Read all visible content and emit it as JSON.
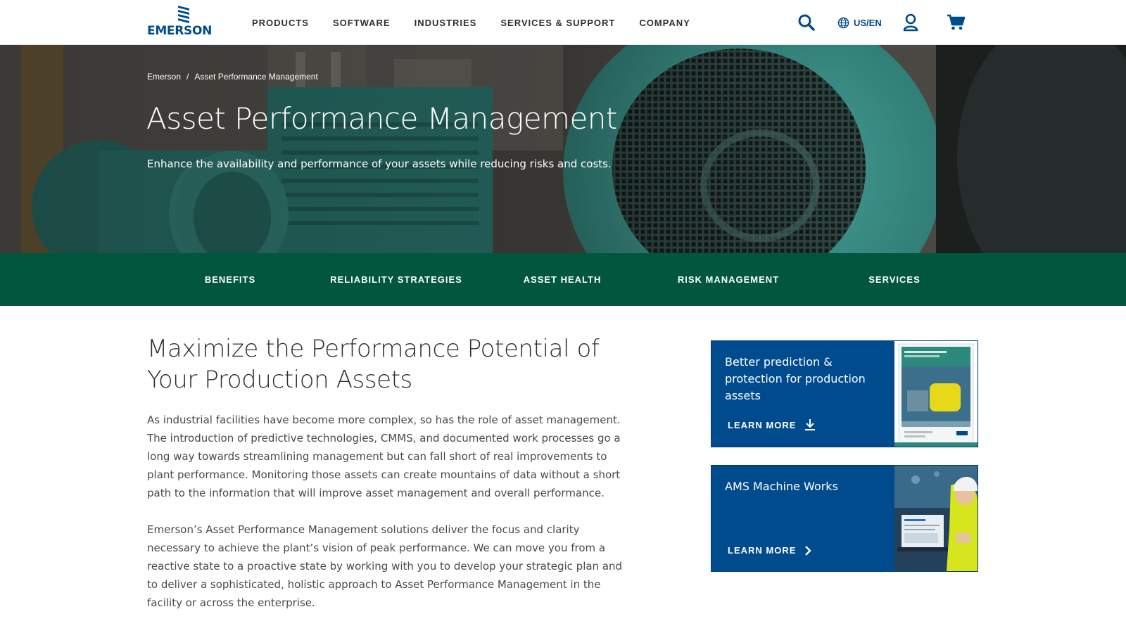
{
  "header": {
    "logo_text": "EMERSON",
    "nav": [
      "PRODUCTS",
      "SOFTWARE",
      "INDUSTRIES",
      "SERVICES & SUPPORT",
      "COMPANY"
    ],
    "locale": "US/EN",
    "icons": [
      "search-icon",
      "globe-icon",
      "user-icon",
      "cart-icon"
    ],
    "brand_color": "#004b8d"
  },
  "hero": {
    "breadcrumb": [
      "Emerson",
      "/",
      "Asset Performance Management"
    ],
    "title": "Asset Performance Management",
    "subtitle": "Enhance the availability and performance of your assets while reducing risks and costs."
  },
  "subnav": {
    "items": [
      "BENEFITS",
      "RELIABILITY STRATEGIES",
      "ASSET HEALTH",
      "RISK MANAGEMENT",
      "SERVICES"
    ],
    "background": "#00573d"
  },
  "main": {
    "heading": "Maximize the Performance Potential of Your Production Assets",
    "paragraphs": [
      "As industrial facilities have become more complex, so has the role of asset management. The introduction of predictive technologies, CMMS, and documented work processes go a long way towards streamlining management but can fall short of real improvements to plant performance. Monitoring those assets can create mountains of data without a short path to the information that will improve asset management and overall performance.",
      "Emerson’s Asset Performance Management solutions deliver the focus and clarity necessary to achieve the plant’s vision of peak performance. We can move you from a reactive state to a proactive state by working with you to develop your strategic plan and to deliver a sophisticated, holistic approach to Asset Performance Management in the facility or across the enterprise."
    ]
  },
  "cards": [
    {
      "title": "Better prediction & protection for production assets",
      "cta": "LEARN MORE",
      "cta_icon": "download-icon"
    },
    {
      "title": "AMS Machine Works",
      "cta": "LEARN MORE",
      "cta_icon": "chevron-right-icon"
    }
  ]
}
